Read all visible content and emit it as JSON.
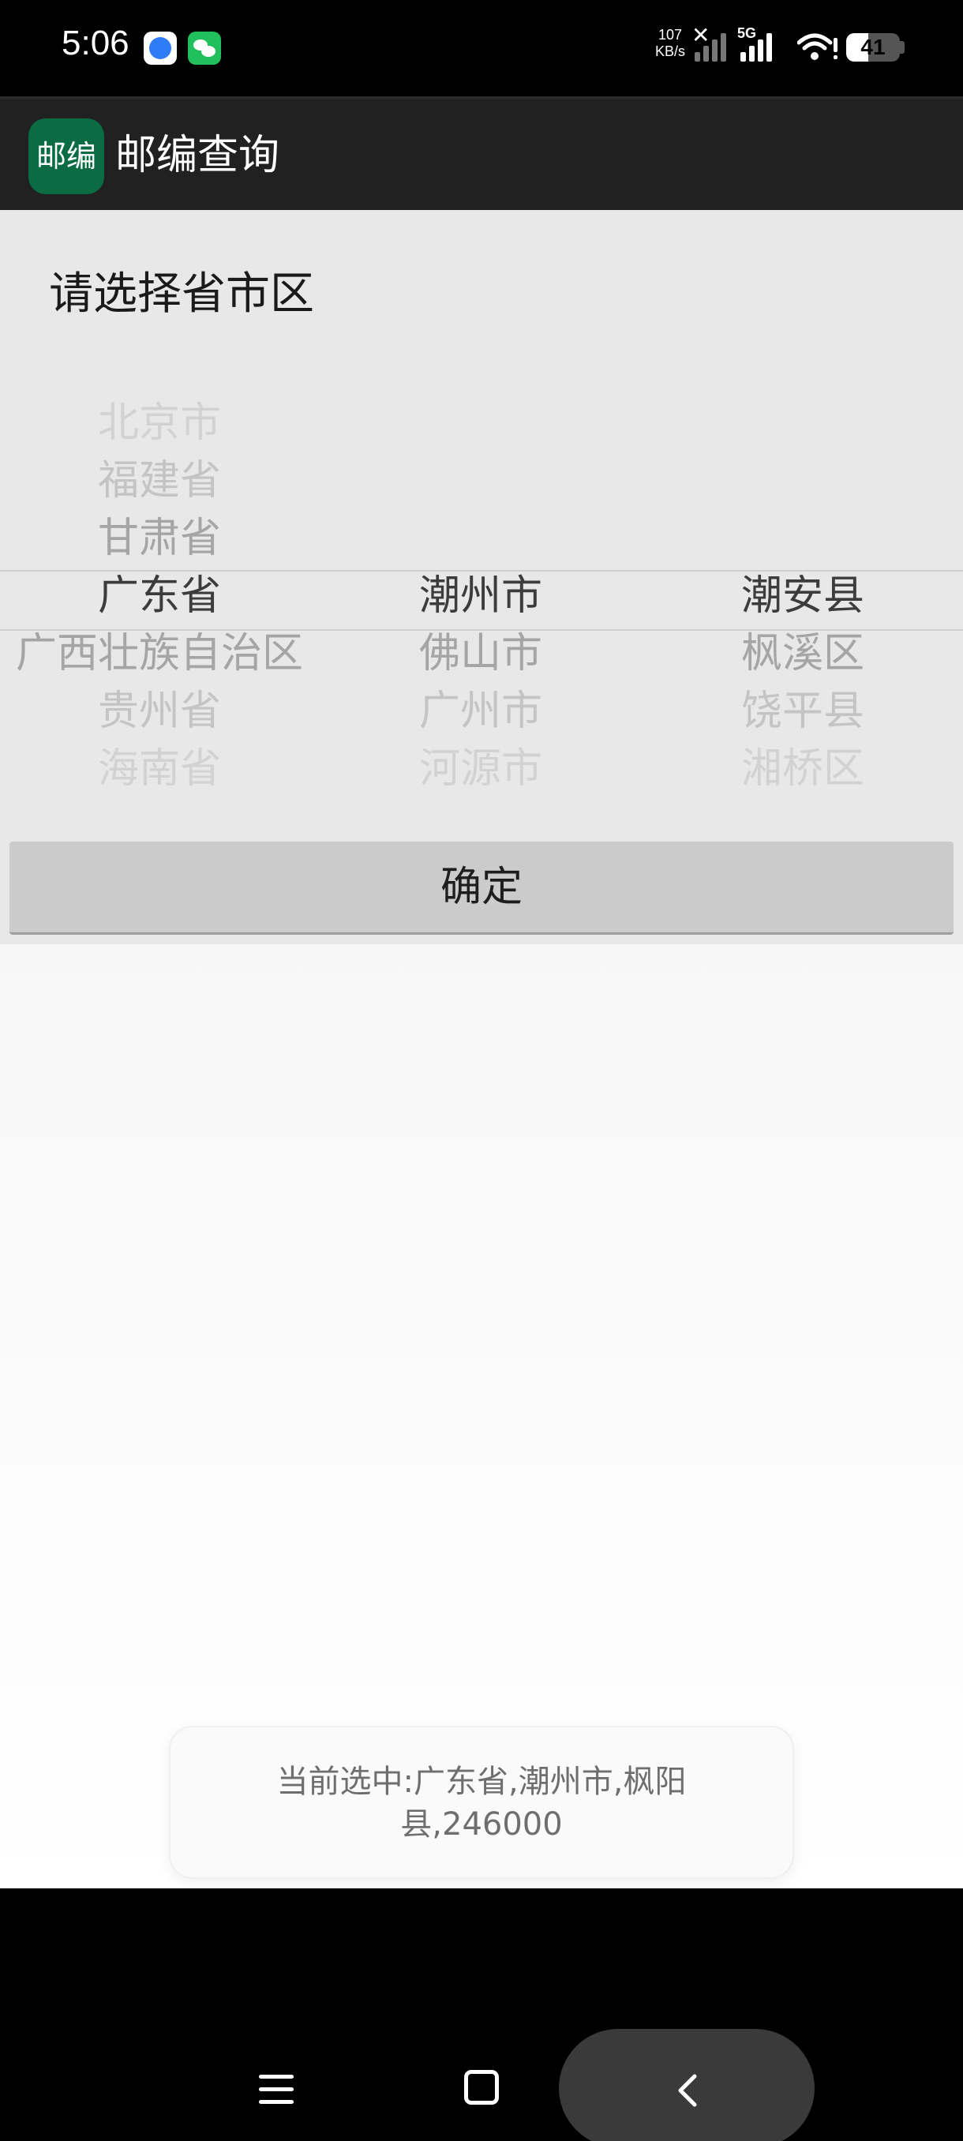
{
  "status_bar": {
    "time": "5:06",
    "net_speed_value": "107",
    "net_speed_unit": "KB/s",
    "network_type": "5G",
    "battery_level": "41",
    "battery_fraction": 0.41,
    "icons": [
      "browser-app-icon",
      "wechat-app-icon",
      "no-sim-icon",
      "signal-icon",
      "wifi-icon",
      "battery-icon"
    ]
  },
  "app_bar": {
    "icon_text": "邮编",
    "title": "邮编查询",
    "icon_color": "#0b6b43"
  },
  "picker": {
    "prompt": "请选择省市区",
    "province": {
      "above": [
        "北京市",
        "福建省",
        "甘肃省"
      ],
      "selected": "广东省",
      "below": [
        "广西壮族自治区",
        "贵州省",
        "海南省"
      ]
    },
    "city": {
      "above": [],
      "selected": "潮州市",
      "below": [
        "佛山市",
        "广州市",
        "河源市"
      ]
    },
    "district": {
      "above": [],
      "selected": "潮安县",
      "below": [
        "枫溪区",
        "饶平县",
        "湘桥区"
      ]
    },
    "confirm_label": "确定"
  },
  "toast": {
    "message": "当前选中:广东省,潮州市,枫阳县,246000"
  },
  "nav_bar": {
    "icons": [
      "menu-icon",
      "home-icon",
      "back-icon"
    ]
  }
}
